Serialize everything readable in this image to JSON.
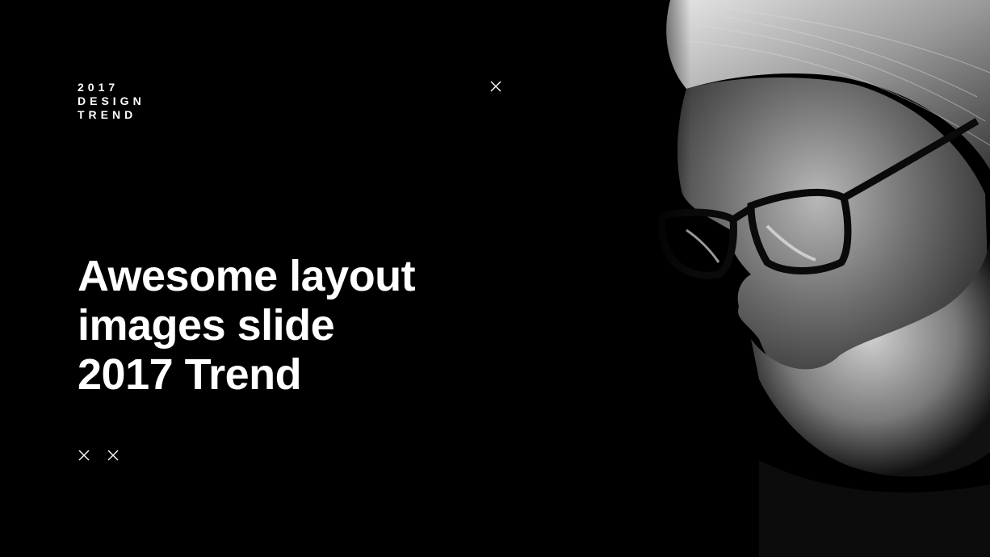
{
  "slide": {
    "label_lines": [
      "2017",
      "DESIGN",
      "TREND"
    ],
    "headline_lines": [
      "Awesome layout",
      "images slide",
      "2017 Trend"
    ]
  },
  "icons": {
    "top": "close-icon",
    "bottom_left": "close-icon",
    "bottom_right": "close-icon"
  },
  "portrait": {
    "subject": "monochrome portrait of bearded man with glasses"
  },
  "colors": {
    "background": "#000000",
    "text": "#ffffff"
  }
}
